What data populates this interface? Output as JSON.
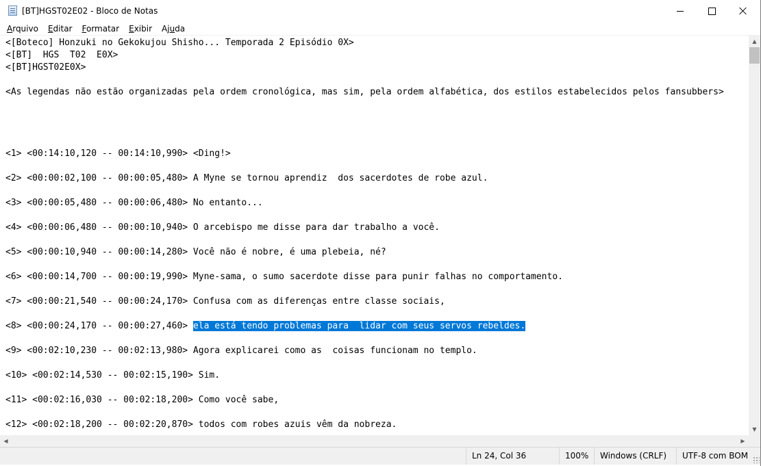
{
  "window": {
    "title": "[BT]HGST02E02 - Bloco de Notas",
    "controls": {
      "minimize": "minimize",
      "maximize": "maximize",
      "close": "close"
    }
  },
  "menu": [
    {
      "access": "A",
      "rest": "rquivo"
    },
    {
      "access": "E",
      "rest": "ditar"
    },
    {
      "access": "F",
      "rest": "ormatar"
    },
    {
      "access": "E",
      "rest": "xibir"
    },
    {
      "pre": "Aj",
      "access": "u",
      "rest": "da"
    }
  ],
  "editor": {
    "lines": [
      "<[Boteco] Honzuki no Gekokujou Shisho... Temporada 2 Episódio 0X>",
      "<[BT]  HGS  T02  E0X>",
      "<[BT]HGST02E0X>",
      "<As legendas não estão organizadas pela ordem cronológica, mas sim, pela ordem alfabética, dos estilos estabelecidos pelos fansubbers>",
      "<1> <00:14:10,120 -- 00:14:10,990> <Ding!>",
      "<2> <00:00:02,100 -- 00:00:05,480> A Myne se tornou aprendiz  dos sacerdotes de robe azul.",
      "<3> <00:00:05,480 -- 00:00:06,480> No entanto...",
      "<4> <00:00:06,480 -- 00:00:10,940> O arcebispo me disse para dar trabalho a você.",
      "<5> <00:00:10,940 -- 00:00:14,280> Você não é nobre, é uma plebeia, né?",
      "<6> <00:00:14,700 -- 00:00:19,990> Myne-sama, o sumo sacerdote disse para punir falhas no comportamento.",
      "<7> <00:00:21,540 -- 00:00:24,170> Confusa com as diferenças entre classe sociais,",
      "<8> <00:00:24,170 -- 00:00:27,460> ",
      "<9> <00:02:10,230 -- 00:02:13,980> Agora explicarei como as  coisas funcionam no templo.",
      "<10> <00:02:14,530 -- 00:02:15,190> Sim.",
      "<11> <00:02:16,030 -- 00:02:18,200> Como você sabe,",
      "<12> <00:02:18,200 -- 00:02:20,870> todos com robes azuis vêm da nobreza."
    ],
    "selected_text": "ela está tendo problemas para  lidar com seus servos rebeldes."
  },
  "status": {
    "position": "Ln 24, Col 36",
    "zoom": "100%",
    "line_endings": "Windows (CRLF)",
    "encoding": "UTF-8 com BOM"
  },
  "colors": {
    "selection": "#0078d7",
    "statusbar": "#f0f0f0"
  }
}
